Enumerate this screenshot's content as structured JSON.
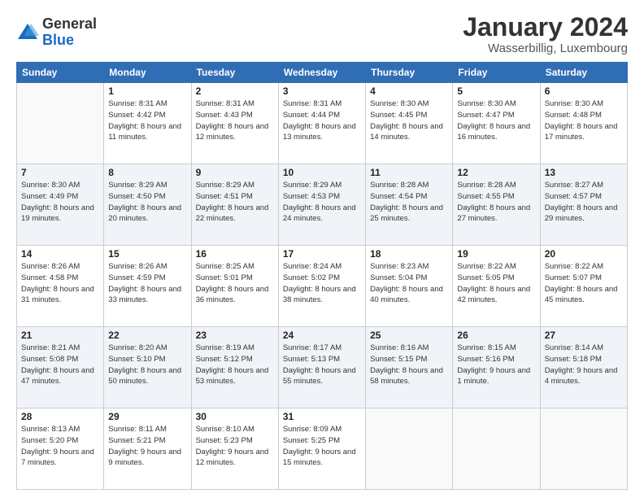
{
  "logo": {
    "general": "General",
    "blue": "Blue"
  },
  "title": "January 2024",
  "location": "Wasserbillig, Luxembourg",
  "days_header": [
    "Sunday",
    "Monday",
    "Tuesday",
    "Wednesday",
    "Thursday",
    "Friday",
    "Saturday"
  ],
  "weeks": [
    [
      {
        "day": "",
        "sunrise": "",
        "sunset": "",
        "daylight": ""
      },
      {
        "day": "1",
        "sunrise": "Sunrise: 8:31 AM",
        "sunset": "Sunset: 4:42 PM",
        "daylight": "Daylight: 8 hours and 11 minutes."
      },
      {
        "day": "2",
        "sunrise": "Sunrise: 8:31 AM",
        "sunset": "Sunset: 4:43 PM",
        "daylight": "Daylight: 8 hours and 12 minutes."
      },
      {
        "day": "3",
        "sunrise": "Sunrise: 8:31 AM",
        "sunset": "Sunset: 4:44 PM",
        "daylight": "Daylight: 8 hours and 13 minutes."
      },
      {
        "day": "4",
        "sunrise": "Sunrise: 8:30 AM",
        "sunset": "Sunset: 4:45 PM",
        "daylight": "Daylight: 8 hours and 14 minutes."
      },
      {
        "day": "5",
        "sunrise": "Sunrise: 8:30 AM",
        "sunset": "Sunset: 4:47 PM",
        "daylight": "Daylight: 8 hours and 16 minutes."
      },
      {
        "day": "6",
        "sunrise": "Sunrise: 8:30 AM",
        "sunset": "Sunset: 4:48 PM",
        "daylight": "Daylight: 8 hours and 17 minutes."
      }
    ],
    [
      {
        "day": "7",
        "sunrise": "Sunrise: 8:30 AM",
        "sunset": "Sunset: 4:49 PM",
        "daylight": "Daylight: 8 hours and 19 minutes."
      },
      {
        "day": "8",
        "sunrise": "Sunrise: 8:29 AM",
        "sunset": "Sunset: 4:50 PM",
        "daylight": "Daylight: 8 hours and 20 minutes."
      },
      {
        "day": "9",
        "sunrise": "Sunrise: 8:29 AM",
        "sunset": "Sunset: 4:51 PM",
        "daylight": "Daylight: 8 hours and 22 minutes."
      },
      {
        "day": "10",
        "sunrise": "Sunrise: 8:29 AM",
        "sunset": "Sunset: 4:53 PM",
        "daylight": "Daylight: 8 hours and 24 minutes."
      },
      {
        "day": "11",
        "sunrise": "Sunrise: 8:28 AM",
        "sunset": "Sunset: 4:54 PM",
        "daylight": "Daylight: 8 hours and 25 minutes."
      },
      {
        "day": "12",
        "sunrise": "Sunrise: 8:28 AM",
        "sunset": "Sunset: 4:55 PM",
        "daylight": "Daylight: 8 hours and 27 minutes."
      },
      {
        "day": "13",
        "sunrise": "Sunrise: 8:27 AM",
        "sunset": "Sunset: 4:57 PM",
        "daylight": "Daylight: 8 hours and 29 minutes."
      }
    ],
    [
      {
        "day": "14",
        "sunrise": "Sunrise: 8:26 AM",
        "sunset": "Sunset: 4:58 PM",
        "daylight": "Daylight: 8 hours and 31 minutes."
      },
      {
        "day": "15",
        "sunrise": "Sunrise: 8:26 AM",
        "sunset": "Sunset: 4:59 PM",
        "daylight": "Daylight: 8 hours and 33 minutes."
      },
      {
        "day": "16",
        "sunrise": "Sunrise: 8:25 AM",
        "sunset": "Sunset: 5:01 PM",
        "daylight": "Daylight: 8 hours and 36 minutes."
      },
      {
        "day": "17",
        "sunrise": "Sunrise: 8:24 AM",
        "sunset": "Sunset: 5:02 PM",
        "daylight": "Daylight: 8 hours and 38 minutes."
      },
      {
        "day": "18",
        "sunrise": "Sunrise: 8:23 AM",
        "sunset": "Sunset: 5:04 PM",
        "daylight": "Daylight: 8 hours and 40 minutes."
      },
      {
        "day": "19",
        "sunrise": "Sunrise: 8:22 AM",
        "sunset": "Sunset: 5:05 PM",
        "daylight": "Daylight: 8 hours and 42 minutes."
      },
      {
        "day": "20",
        "sunrise": "Sunrise: 8:22 AM",
        "sunset": "Sunset: 5:07 PM",
        "daylight": "Daylight: 8 hours and 45 minutes."
      }
    ],
    [
      {
        "day": "21",
        "sunrise": "Sunrise: 8:21 AM",
        "sunset": "Sunset: 5:08 PM",
        "daylight": "Daylight: 8 hours and 47 minutes."
      },
      {
        "day": "22",
        "sunrise": "Sunrise: 8:20 AM",
        "sunset": "Sunset: 5:10 PM",
        "daylight": "Daylight: 8 hours and 50 minutes."
      },
      {
        "day": "23",
        "sunrise": "Sunrise: 8:19 AM",
        "sunset": "Sunset: 5:12 PM",
        "daylight": "Daylight: 8 hours and 53 minutes."
      },
      {
        "day": "24",
        "sunrise": "Sunrise: 8:17 AM",
        "sunset": "Sunset: 5:13 PM",
        "daylight": "Daylight: 8 hours and 55 minutes."
      },
      {
        "day": "25",
        "sunrise": "Sunrise: 8:16 AM",
        "sunset": "Sunset: 5:15 PM",
        "daylight": "Daylight: 8 hours and 58 minutes."
      },
      {
        "day": "26",
        "sunrise": "Sunrise: 8:15 AM",
        "sunset": "Sunset: 5:16 PM",
        "daylight": "Daylight: 9 hours and 1 minute."
      },
      {
        "day": "27",
        "sunrise": "Sunrise: 8:14 AM",
        "sunset": "Sunset: 5:18 PM",
        "daylight": "Daylight: 9 hours and 4 minutes."
      }
    ],
    [
      {
        "day": "28",
        "sunrise": "Sunrise: 8:13 AM",
        "sunset": "Sunset: 5:20 PM",
        "daylight": "Daylight: 9 hours and 7 minutes."
      },
      {
        "day": "29",
        "sunrise": "Sunrise: 8:11 AM",
        "sunset": "Sunset: 5:21 PM",
        "daylight": "Daylight: 9 hours and 9 minutes."
      },
      {
        "day": "30",
        "sunrise": "Sunrise: 8:10 AM",
        "sunset": "Sunset: 5:23 PM",
        "daylight": "Daylight: 9 hours and 12 minutes."
      },
      {
        "day": "31",
        "sunrise": "Sunrise: 8:09 AM",
        "sunset": "Sunset: 5:25 PM",
        "daylight": "Daylight: 9 hours and 15 minutes."
      },
      {
        "day": "",
        "sunrise": "",
        "sunset": "",
        "daylight": ""
      },
      {
        "day": "",
        "sunrise": "",
        "sunset": "",
        "daylight": ""
      },
      {
        "day": "",
        "sunrise": "",
        "sunset": "",
        "daylight": ""
      }
    ]
  ]
}
